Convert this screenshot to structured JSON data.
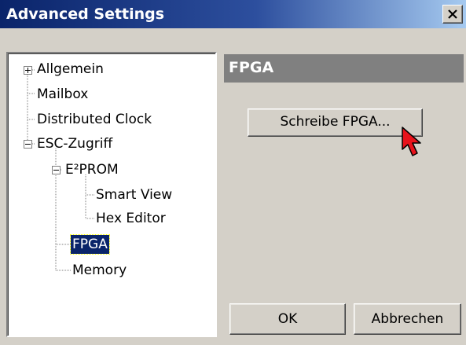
{
  "window": {
    "title": "Advanced Settings"
  },
  "tree": {
    "items": [
      {
        "label": "Allgemein",
        "expander": "+"
      },
      {
        "label": "Mailbox"
      },
      {
        "label": "Distributed Clock"
      },
      {
        "label": "ESC-Zugriff",
        "expander": "-"
      },
      {
        "label": "E²PROM",
        "expander": "-"
      },
      {
        "label": "Smart View"
      },
      {
        "label": "Hex Editor"
      },
      {
        "label": "FPGA",
        "selected": true
      },
      {
        "label": "Memory"
      }
    ]
  },
  "panel": {
    "header": "FPGA",
    "write_button": "Schreibe FPGA..."
  },
  "buttons": {
    "ok": "OK",
    "cancel": "Abbrechen"
  },
  "colors": {
    "title_bar": "#0a246a",
    "selection": "#0a246a",
    "panel_header": "#808080",
    "cursor": "#e8121b"
  }
}
